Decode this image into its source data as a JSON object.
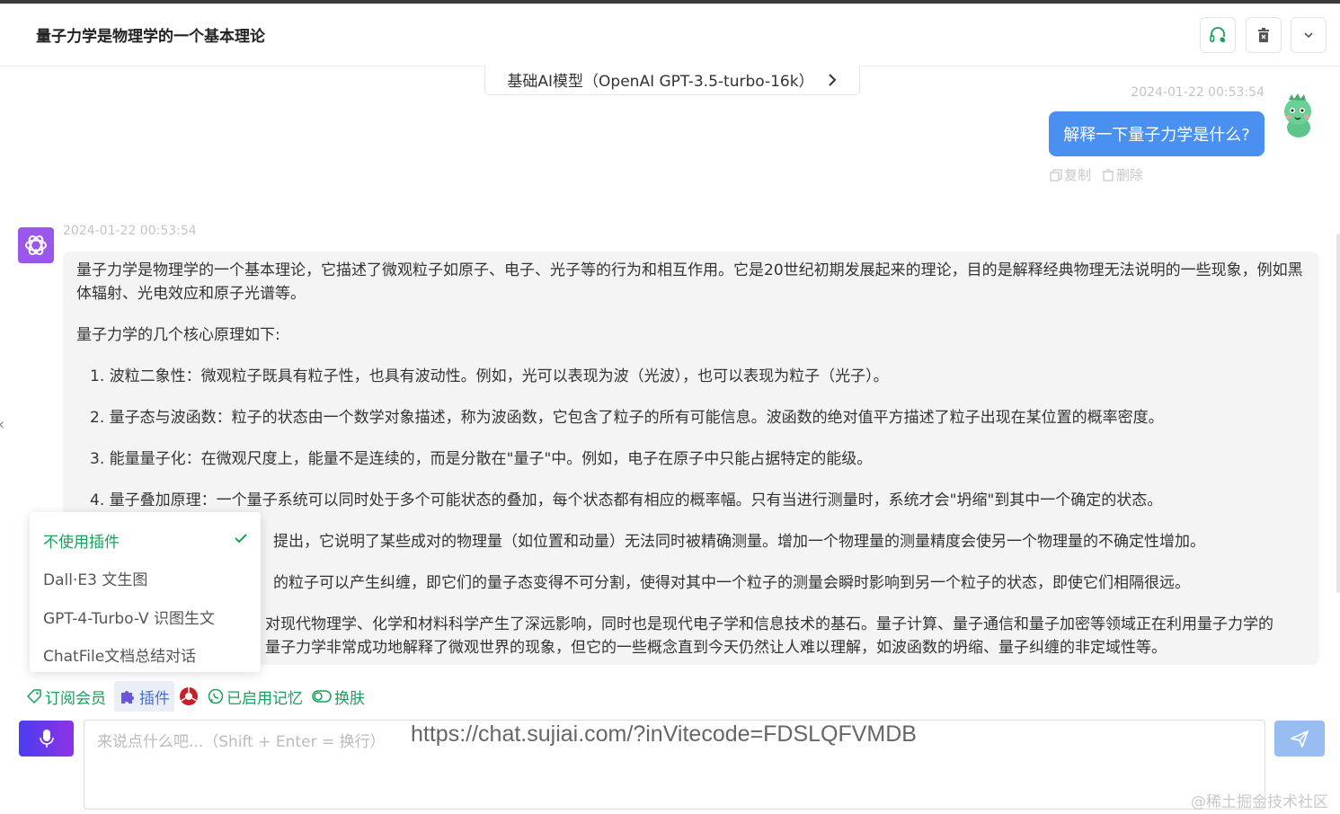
{
  "header": {
    "title": "量子力学是物理学的一个基本理论",
    "icons": [
      "headset-icon",
      "trash-icon",
      "chevron-down-icon"
    ]
  },
  "model": {
    "label": "基础AI模型（OpenAI GPT-3.5-turbo-16k）"
  },
  "user_message": {
    "timestamp": "2024-01-22 00:53:54",
    "text": "解释一下量子力学是什么?",
    "copy_label": "复制",
    "delete_label": "删除"
  },
  "bot_message": {
    "timestamp": "2024-01-22 00:53:54",
    "intro": "量子力学是物理学的一个基本理论，它描述了微观粒子如原子、电子、光子等的行为和相互作用。它是20世纪初期发展起来的理论，目的是解释经典物理无法说明的一些现象，例如黑体辐射、光电效应和原子光谱等。",
    "principles_heading": "量子力学的几个核心原理如下:",
    "principles": [
      "1. 波粒二象性：微观粒子既具有粒子性，也具有波动性。例如，光可以表现为波（光波），也可以表现为粒子（光子）。",
      "2. 量子态与波函数：粒子的状态由一个数学对象描述，称为波函数，它包含了粒子的所有可能信息。波函数的绝对值平方描述了粒子出现在某位置的概率密度。",
      "3. 能量量子化：在微观尺度上，能量不是连续的，而是分散在\"量子\"中。例如，电子在原子中只能占据特定的能级。",
      "4. 量子叠加原理：一个量子系统可以同时处于多个可能状态的叠加，每个状态都有相应的概率幅。只有当进行测量时，系统才会\"坍缩\"到其中一个确定的状态。",
      "提出，它说明了某些成对的物理量（如位置和动量）无法同时被精确测量。增加一个物理量的测量精度会使另一个物理量的不确定性增加。",
      "的粒子可以产生纠缠，即它们的量子态变得不可分割，使得对其中一个粒子的测量会瞬时影响到另一个粒子的状态，即使它们相隔很远。"
    ],
    "closing_line1": "对现代物理学、化学和材料科学产生了深远影响，同时也是现代电子学和信息技术的基石。量子计算、量子通信和量子加密等领域正在利用量子力学的",
    "closing_line2": "量子力学非常成功地解释了微观世界的现象，但它的一些概念直到今天仍然让人难以理解，如波函数的坍缩、量子纠缠的非定域性等。"
  },
  "plugin_menu": {
    "items": [
      {
        "label": "不使用插件",
        "active": true
      },
      {
        "label": "Dall·E3 文生图",
        "active": false
      },
      {
        "label": "GPT-4-Turbo-V 识图生文",
        "active": false
      },
      {
        "label": "ChatFile文档总结对话",
        "active": false
      }
    ]
  },
  "toolbar": {
    "subscribe": "订阅会员",
    "plugin": "插件",
    "memory": "已启用记忆",
    "skin": "换肤"
  },
  "input": {
    "placeholder": "来说点什么吧...（Shift + Enter = 换行）",
    "invite_text": "https://chat.sujiai.com/?inVitecode=FDSLQFVMDB"
  },
  "watermark": "@稀土掘金技术社区",
  "colors": {
    "accent_green": "#19a05a",
    "user_bubble": "#4a90f0",
    "bot_bubble": "#f4f4f5",
    "mic_gradient_start": "#4b3df0",
    "mic_gradient_end": "#8f32e6",
    "send_button": "#98bdf3"
  }
}
